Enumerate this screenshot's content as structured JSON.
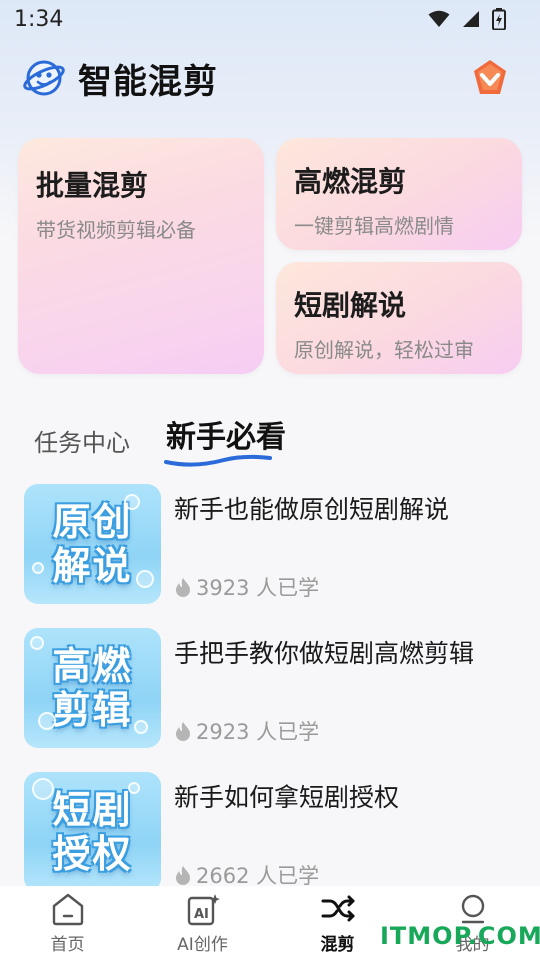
{
  "status_bar": {
    "time": "1:34"
  },
  "header": {
    "title": "智能混剪"
  },
  "feature_cards": [
    {
      "title": "批量混剪",
      "subtitle": "带货视频剪辑必备"
    },
    {
      "title": "高燃混剪",
      "subtitle": "一键剪辑高燃剧情"
    },
    {
      "title": "短剧解说",
      "subtitle": "原创解说，轻松过审"
    }
  ],
  "tabs": [
    {
      "label": "任务中心",
      "active": false
    },
    {
      "label": "新手必看",
      "active": true
    }
  ],
  "tutorials": [
    {
      "thumb_line1": "原创",
      "thumb_line2": "解说",
      "title": "新手也能做原创短剧解说",
      "learners": "3923 人已学"
    },
    {
      "thumb_line1": "高燃",
      "thumb_line2": "剪辑",
      "title": "手把手教你做短剧高燃剪辑",
      "learners": "2923 人已学"
    },
    {
      "thumb_line1": "短剧",
      "thumb_line2": "授权",
      "title": "新手如何拿短剧授权",
      "learners": "2662 人已学"
    }
  ],
  "bottom_nav": [
    {
      "label": "首页",
      "icon": "home-icon",
      "active": false
    },
    {
      "label": "AI创作",
      "icon": "ai-create-icon",
      "active": false
    },
    {
      "label": "混剪",
      "icon": "shuffle-icon",
      "active": true
    },
    {
      "label": "我的",
      "icon": "profile-icon",
      "active": false
    }
  ],
  "watermark": "ITMOP.COM",
  "colors": {
    "accent": "#2a6bd9",
    "vip_badge": "#f06a3c",
    "watermark": "#18a85a"
  }
}
